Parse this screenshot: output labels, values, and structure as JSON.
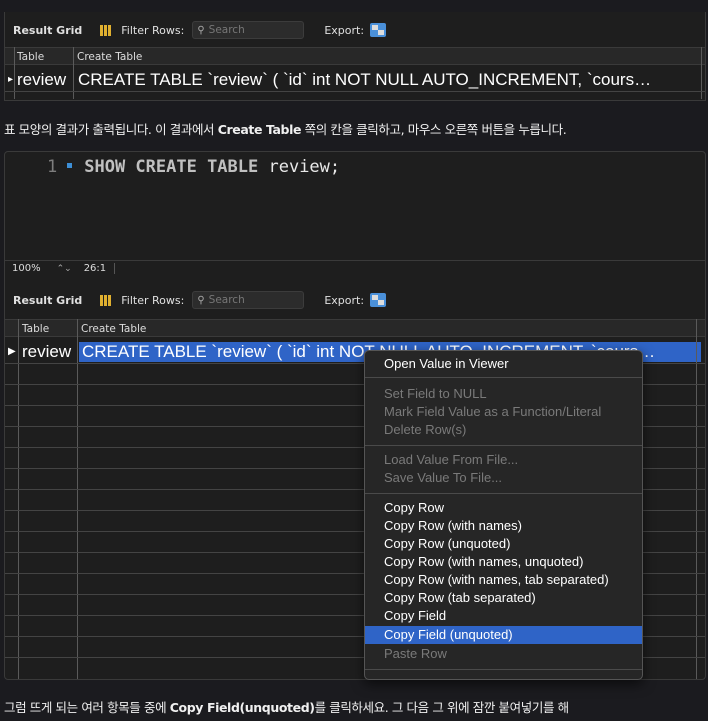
{
  "panel1": {
    "result_grid_label": "Result Grid",
    "filter_rows_label": "Filter Rows:",
    "search_placeholder": "Search",
    "export_label": "Export:",
    "columns": [
      "Table",
      "Create Table"
    ],
    "row": {
      "table": "review",
      "create_table": "CREATE TABLE `review` (   `id` int NOT NULL AUTO_INCREMENT,   `cours…"
    }
  },
  "caption1": {
    "before": "표 모양의 결과가 출력됩니다. 이 결과에서 ",
    "bold": "Create Table",
    "after": " 쪽의 칸을 클릭하고, 마우스 오른쪽 버튼을 누릅니다."
  },
  "editor": {
    "line_number": "1",
    "keyword": "SHOW CREATE TABLE",
    "rest": " review;",
    "zoom": "100%",
    "cursor_pos": "26:1"
  },
  "panel2": {
    "result_grid_label": "Result Grid",
    "filter_rows_label": "Filter Rows:",
    "search_placeholder": "Search",
    "export_label": "Export:",
    "columns": [
      "Table",
      "Create Table"
    ],
    "row": {
      "table": "review",
      "create_table": "CREATE TABLE `review` (   `id` int NOT NULL AUTO_INCREMENT,   `cours…"
    }
  },
  "context_menu": {
    "items": [
      {
        "label": "Open Value in Viewer",
        "enabled": true
      },
      {
        "label": "Set Field to NULL",
        "enabled": false
      },
      {
        "label": "Mark Field Value as a Function/Literal",
        "enabled": false
      },
      {
        "label": "Delete Row(s)",
        "enabled": false
      },
      {
        "label": "Load Value From File...",
        "enabled": false
      },
      {
        "label": "Save Value To File...",
        "enabled": false
      },
      {
        "label": "Copy Row",
        "enabled": true
      },
      {
        "label": "Copy Row (with names)",
        "enabled": true
      },
      {
        "label": "Copy Row (unquoted)",
        "enabled": true
      },
      {
        "label": "Copy Row (with names, unquoted)",
        "enabled": true
      },
      {
        "label": "Copy Row (with names, tab separated)",
        "enabled": true
      },
      {
        "label": "Copy Row (tab separated)",
        "enabled": true
      },
      {
        "label": "Copy Field",
        "enabled": true
      },
      {
        "label": "Copy Field (unquoted)",
        "enabled": true,
        "selected": true
      },
      {
        "label": "Paste Row",
        "enabled": false
      }
    ]
  },
  "caption2": {
    "before": "그럼 뜨게 되는 여러 항목들 중에 ",
    "bold": "Copy Field(unquoted)",
    "after": "를 클릭하세요. 그 다음 그 위에 잠깐 붙여넣기를 해"
  },
  "colors": {
    "accent": "#2f64c7",
    "selection": "#2f64c7",
    "bullet": "#3d8fd6"
  }
}
